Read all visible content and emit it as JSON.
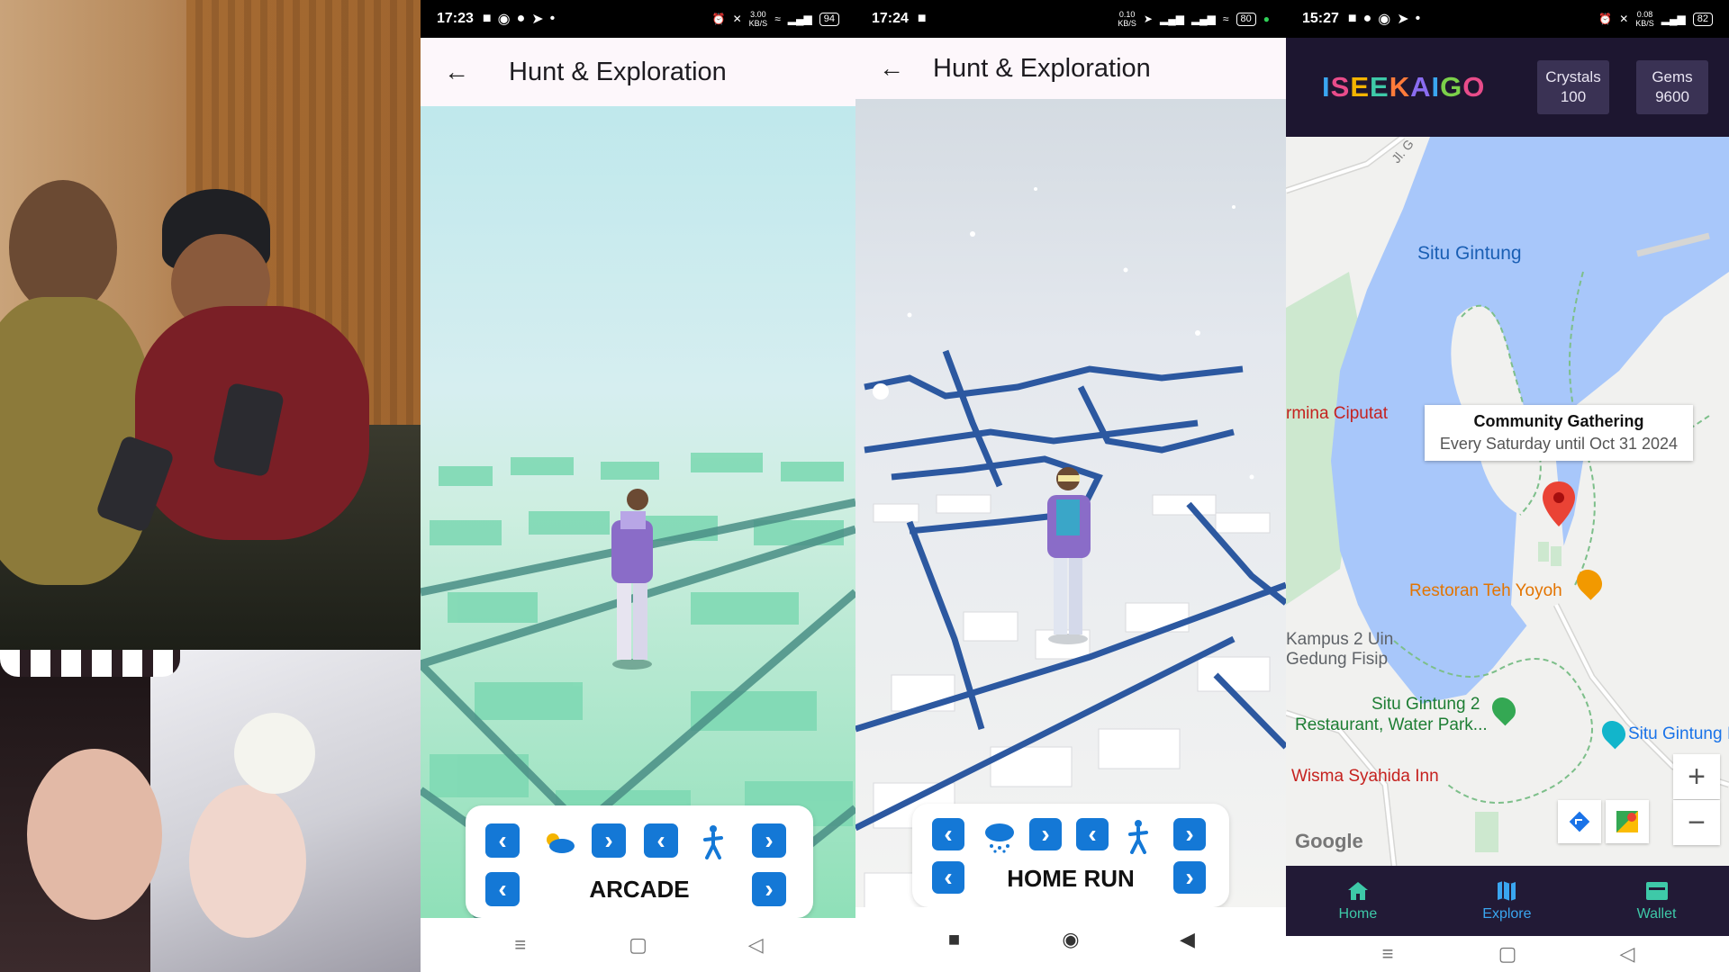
{
  "phone2": {
    "status": {
      "time": "17:23",
      "speed": "3.00",
      "speed_unit": "KB/S",
      "battery": "94"
    },
    "title": "Hunt & Exploration",
    "mode_label": "ARCADE",
    "weather_icon": "partly-cloudy-icon",
    "movement_icon": "walking-person-icon"
  },
  "phone3": {
    "status": {
      "time": "17:24",
      "speed": "0.10",
      "speed_unit": "KB/S",
      "battery": "80"
    },
    "title": "Hunt & Exploration",
    "mode_label": "HOME RUN",
    "weather_icon": "snow-cloud-icon",
    "movement_icon": "walking-person-icon"
  },
  "phone4": {
    "status": {
      "time": "15:27",
      "speed": "0.08",
      "speed_unit": "KB/S",
      "battery": "82"
    },
    "logo": "ISEEKAIGO",
    "logo_colors": [
      "#3aa6f0",
      "#e84c8a",
      "#f4b400",
      "#3ec9a8",
      "#ff7b3a",
      "#8a6cf0",
      "#3aa6f0",
      "#7bd04a",
      "#e84c8a"
    ],
    "stats": [
      {
        "label": "Crystals",
        "value": "100"
      },
      {
        "label": "Gems",
        "value": "9600"
      }
    ],
    "map": {
      "lake_label": "Situ Gintung",
      "road_label": "Jl. G",
      "places": [
        {
          "name": "rmina Ciputat",
          "color": "#c5221f"
        },
        {
          "name": "Restoran Teh Yoyoh",
          "color": "#e37400"
        },
        {
          "name": "Kampus 2 Uin",
          "color": "#5f6368"
        },
        {
          "name": "Gedung Fisip",
          "color": "#5f6368"
        },
        {
          "name": "Situ Gintung 2",
          "color": "#1e7e34"
        },
        {
          "name": "Restaurant, Water Park...",
          "color": "#1e7e34"
        },
        {
          "name": "Situ Gintung I",
          "color": "#1a73e8"
        },
        {
          "name": "Wisma Syahida Inn",
          "color": "#c5221f"
        }
      ],
      "info_window": {
        "title": "Community Gathering",
        "subtitle": "Every Saturday until Oct 31 2024"
      },
      "attribution": "Google",
      "zoom_in": "+",
      "zoom_out": "−"
    },
    "nav": [
      {
        "label": "Home",
        "icon": "home-icon",
        "active": false
      },
      {
        "label": "Explore",
        "icon": "map-icon",
        "active": true
      },
      {
        "label": "Wallet",
        "icon": "wallet-icon",
        "active": false
      }
    ]
  },
  "colors": {
    "accent_blue": "#1478d6",
    "app_dark": "#1d1630",
    "nav_dark": "#221a36",
    "lake": "#a8c7fa"
  }
}
